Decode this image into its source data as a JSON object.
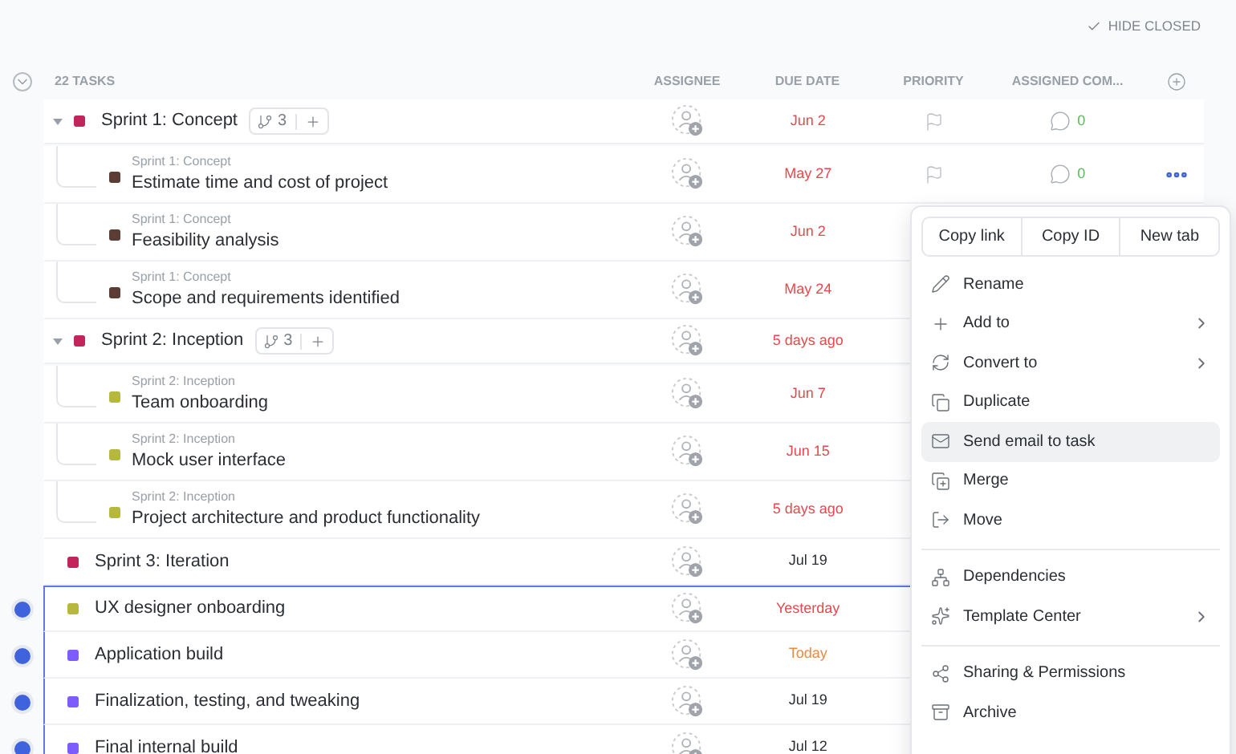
{
  "toolbar": {
    "hide_closed": "HIDE CLOSED"
  },
  "header": {
    "count": "22 TASKS",
    "columns": [
      "ASSIGNEE",
      "DUE DATE",
      "PRIORITY",
      "ASSIGNED COM..."
    ]
  },
  "rows": [
    {
      "kind": "group",
      "name": "Sprint 1: Concept",
      "color": "#c2255c",
      "expanded": true,
      "subtasks": "3",
      "due": {
        "text": "Jun 2",
        "color": "#e5484d"
      },
      "comments": "0",
      "selected": false,
      "menu_open": false
    },
    {
      "kind": "subtask",
      "parent": "Sprint 1: Concept",
      "name": "Estimate time and cost of project",
      "color": "#5c3d35",
      "due": {
        "text": "May 27",
        "color": "#e5484d"
      },
      "comments": "0",
      "selected": false,
      "menu_open": true
    },
    {
      "kind": "subtask",
      "parent": "Sprint 1: Concept",
      "name": "Feasibility analysis",
      "color": "#5c3d35",
      "due": {
        "text": "Jun 2",
        "color": "#e5484d"
      },
      "selected": false,
      "menu_open": false
    },
    {
      "kind": "subtask",
      "parent": "Sprint 1: Concept",
      "name": "Scope and requirements identified",
      "color": "#5c3d35",
      "due": {
        "text": "May 24",
        "color": "#e5484d"
      },
      "selected": false,
      "menu_open": false
    },
    {
      "kind": "group",
      "name": "Sprint 2: Inception",
      "color": "#c2255c",
      "expanded": true,
      "subtasks": "3",
      "due": {
        "text": "5 days ago",
        "color": "#e5484d"
      },
      "selected": false,
      "menu_open": false
    },
    {
      "kind": "subtask",
      "parent": "Sprint 2: Inception",
      "name": "Team onboarding",
      "color": "#b5b83b",
      "due": {
        "text": "Jun 7",
        "color": "#e5484d"
      },
      "selected": false,
      "menu_open": false
    },
    {
      "kind": "subtask",
      "parent": "Sprint 2: Inception",
      "name": "Mock user interface",
      "color": "#b5b83b",
      "due": {
        "text": "Jun 15",
        "color": "#e5484d"
      },
      "selected": false,
      "menu_open": false
    },
    {
      "kind": "subtask",
      "parent": "Sprint 2: Inception",
      "name": "Project architecture and product functionality",
      "color": "#b5b83b",
      "due": {
        "text": "5 days ago",
        "color": "#e5484d"
      },
      "selected": false,
      "menu_open": false
    },
    {
      "kind": "task",
      "name": "Sprint 3: Iteration",
      "color": "#c2255c",
      "due": {
        "text": "Jul 19",
        "color": "#2a2e34"
      },
      "selected": false,
      "menu_open": false
    },
    {
      "kind": "task",
      "name": "UX designer onboarding",
      "color": "#b5b83b",
      "due": {
        "text": "Yesterday",
        "color": "#e5484d"
      },
      "selected": true,
      "menu_open": false
    },
    {
      "kind": "task",
      "name": "Application build",
      "color": "#7c5cff",
      "due": {
        "text": "Today",
        "color": "#f0883e"
      },
      "selected": true,
      "menu_open": false
    },
    {
      "kind": "task",
      "name": "Finalization, testing, and tweaking",
      "color": "#7c5cff",
      "due": {
        "text": "Jul 19",
        "color": "#2a2e34"
      },
      "selected": true,
      "menu_open": false
    },
    {
      "kind": "task",
      "name": "Final internal build",
      "color": "#7c5cff",
      "due": {
        "text": "Jul 12",
        "color": "#2a2e34"
      },
      "selected": true,
      "menu_open": false
    }
  ],
  "menu": {
    "quick_actions": [
      "Copy link",
      "Copy ID",
      "New tab"
    ],
    "sections": [
      [
        {
          "label": "Rename",
          "submenu": false,
          "highlighted": false
        },
        {
          "label": "Add to",
          "submenu": true,
          "highlighted": false
        },
        {
          "label": "Convert to",
          "submenu": true,
          "highlighted": false
        },
        {
          "label": "Duplicate",
          "submenu": false,
          "highlighted": false
        },
        {
          "label": "Send email to task",
          "submenu": false,
          "highlighted": true
        },
        {
          "label": "Merge",
          "submenu": false,
          "highlighted": false
        },
        {
          "label": "Move",
          "submenu": false,
          "highlighted": false
        }
      ],
      [
        {
          "label": "Dependencies",
          "submenu": false,
          "highlighted": false
        },
        {
          "label": "Template Center",
          "submenu": true,
          "highlighted": false
        }
      ],
      [
        {
          "label": "Sharing & Permissions",
          "submenu": false,
          "highlighted": false
        },
        {
          "label": "Archive",
          "submenu": false,
          "highlighted": false
        }
      ]
    ]
  }
}
